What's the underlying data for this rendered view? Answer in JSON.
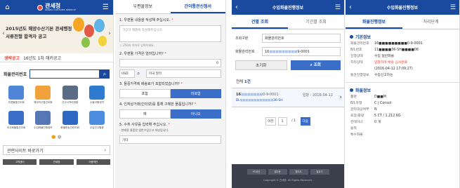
{
  "p1": {
    "logo_text": "관세청",
    "logo_sub": "KOREA CUSTOMS SERVICE",
    "banner_line1": "2015년도 해양수산기본 관세행정",
    "banner_line2": "서류전형 합격자 공고",
    "notice_label": "생략공고",
    "notice_text": "16년도 1차 해커공고",
    "cargo_label": "화물관리번호",
    "grid": [
      {
        "label": "우편물통관조회",
        "color": "#4f86d8"
      },
      {
        "label": "해외직구통관조회",
        "color": "#f0a23b"
      },
      {
        "label": "신고서처리현황",
        "color": "#5a6b86"
      },
      {
        "label": "수출이행내역",
        "color": "#2f7ad1"
      },
      {
        "label": "이사화물통관조회",
        "color": "#3b6ec8"
      },
      {
        "label": "수입화물진행정보",
        "color": "#5577b5"
      },
      {
        "label": "화물운송관련조회",
        "color": "#2e67c4"
      },
      {
        "label": "수입신고필증",
        "color": "#4d8de0"
      }
    ],
    "related_label": "관련사이트 바로가기",
    "related_arrow": "›",
    "footer": [
      "고객센터",
      "관세청",
      "이용약관"
    ]
  },
  "p2": {
    "tab1": "우편물정보",
    "tab2": "간이통관신청서",
    "q1": "1. 우편물 내용을 작성해 주십시오.",
    "q1_placeholder": "가공하 제품에 작성해주십시오.",
    "q1_hint": "250자 이하로 입력하세요.",
    "q2": "2. 우편물 가격은 얼마입니까?",
    "q2_value": "0",
    "currency": "USD",
    "currency_name": "미국 달러",
    "q3": "3. 들중가격에 배송료가 포함되었습니까?",
    "opt_yes": "포함",
    "opt_no": "미포함",
    "q4": "4. 인자상거래(인터넷)를 통해 구매한 물품입니까?",
    "opt_yes2": "예",
    "opt_no2": "아니오",
    "q5": "5. 수취 사유를 입력해 주십시오.",
    "q5_sub": "- 판매용 물품은 일반수입신고 대상입니다.",
    "q5_value": "기타"
  },
  "p3": {
    "title": "수입화물진행정보",
    "subtab1": "건별 조회",
    "subtab2": "기간별 조회",
    "field1_label": "조회구분",
    "field1_value": "화물관리번호",
    "field2_label": "화물관리번호",
    "field2_value": "16",
    "field2_mask": "■■■■■■■■■",
    "field2_tail": "9-0001",
    "reset_label": "초기화",
    "search_label": "조회",
    "total_prefix": "전체",
    "total_count": "1건",
    "result_id_head": "16",
    "result_id_mask": "■■■■■■■",
    "result_id_tail": "0-9-0001",
    "result_date": "입항 : 2016-04-12",
    "result_sub_head": "BL",
    "result_sub_mask": "■■■■■■■■■■■■",
    "result_sub_tail": "36-SH",
    "pager_prev": "이전",
    "pager_page": "1",
    "pager_sep": "/ 1",
    "pager_next": "다음",
    "footer": [
      "PC버전",
      "앱다운",
      "웹지도",
      "멀트기"
    ],
    "copyright": "Copyright © 관세청. All Rights Reserved."
  },
  "p4": {
    "title": "수입화물진행정보",
    "subtab1": "화물진행정보",
    "subtab2": "처리단계",
    "section1": "기본정보",
    "basic": [
      {
        "k": "화물관리번호",
        "v": "16■■■■■■■■■0-9-0001",
        "red": false
      },
      {
        "k": "B/L번호",
        "v": "11■■■■36-SH■■■■08",
        "red": false
      },
      {
        "k": "진행상태",
        "v": "수입 일반화물",
        "red": false
      },
      {
        "k": "처리상태",
        "v": "입항하여 배송 심사완료",
        "red": true
      },
      {
        "k": "",
        "v": "(2016-04-12 17:09:27)",
        "red": false
      },
      {
        "k": "통관진행정보",
        "v": "수입신고하는",
        "red": false
      }
    ],
    "section2": "화물정보",
    "cargo": [
      {
        "k": "품명",
        "v": "D■■M"
      },
      {
        "k": "B/L유형",
        "v": "C | Consol"
      },
      {
        "k": "관리대상여부",
        "v": "N"
      },
      {
        "k": "포장/중량",
        "v": "5 CT / 1,212 KG"
      },
      {
        "k": "컨테이너",
        "v": "0 개"
      },
      {
        "k": "용적",
        "v": ""
      },
      {
        "k": "특수화물",
        "v": ""
      }
    ]
  }
}
